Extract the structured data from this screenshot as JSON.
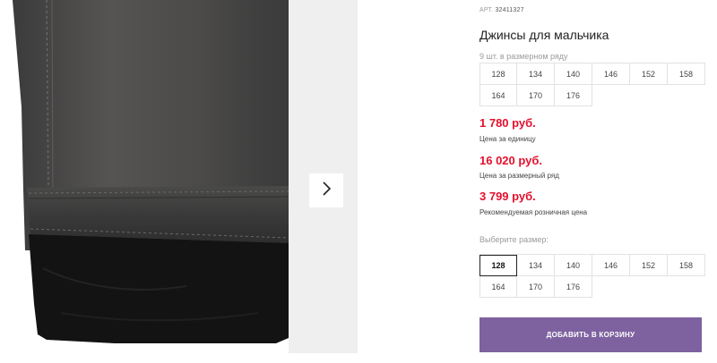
{
  "product": {
    "art_label": "АРТ.",
    "art_number": "32411327",
    "title": "Джинсы для мальчика",
    "pack_note": "9 шт. в размерном ряду"
  },
  "pack_sizes": [
    "128",
    "134",
    "140",
    "146",
    "152",
    "158",
    "164",
    "170",
    "176"
  ],
  "prices": {
    "unit_price": "1 780 руб.",
    "unit_caption": "Цена за единицу",
    "pack_price": "16 020 руб.",
    "pack_caption": "Цена за размерный ряд",
    "retail_price": "3 799 руб.",
    "retail_caption": "Рекомендуемая розничная цена"
  },
  "size_select": {
    "label": "Выберите размер:",
    "options": [
      "128",
      "134",
      "140",
      "146",
      "152",
      "158",
      "164",
      "170",
      "176"
    ],
    "selected": "128"
  },
  "cart": {
    "add_label": "ДОБАВИТЬ В КОРЗИНУ"
  },
  "colors": {
    "accent_price": "#e4102d",
    "button_bg": "#7e62a0"
  },
  "icons": {
    "next": "chevron-right-icon"
  }
}
